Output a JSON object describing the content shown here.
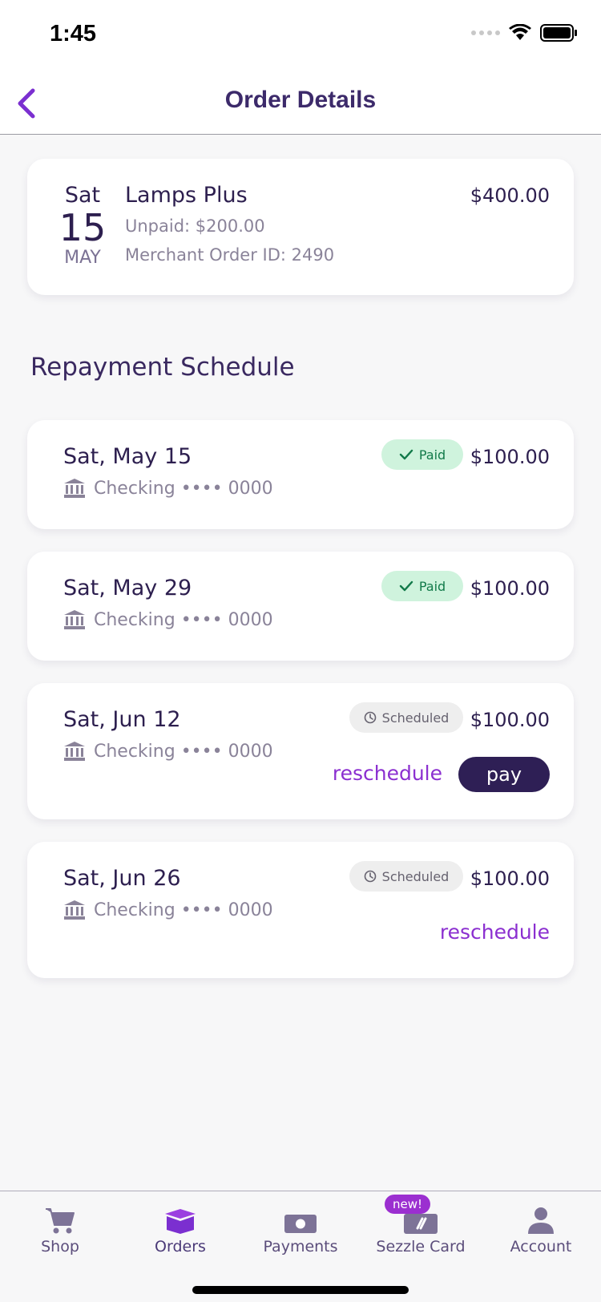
{
  "status_bar": {
    "time": "1:45"
  },
  "nav": {
    "title": "Order Details"
  },
  "order": {
    "day_of_week": "Sat",
    "day": "15",
    "month": "MAY",
    "merchant": "Lamps Plus",
    "unpaid": "Unpaid: $200.00",
    "merchant_order_id": "Merchant Order ID: 2490",
    "total": "$400.00"
  },
  "schedule": {
    "title": "Repayment Schedule",
    "payments": [
      {
        "date": "Sat, May 15",
        "account": "Checking •••• 0000",
        "status": "Paid",
        "amount": "$100.00"
      },
      {
        "date": "Sat, May 29",
        "account": "Checking •••• 0000",
        "status": "Paid",
        "amount": "$100.00"
      },
      {
        "date": "Sat, Jun 12",
        "account": "Checking •••• 0000",
        "status": "Scheduled",
        "amount": "$100.00",
        "reschedule_label": "reschedule",
        "pay_label": "pay"
      },
      {
        "date": "Sat, Jun 26",
        "account": "Checking •••• 0000",
        "status": "Scheduled",
        "amount": "$100.00",
        "reschedule_label": "reschedule"
      }
    ]
  },
  "tabs": [
    {
      "label": "Shop",
      "icon": "cart-icon",
      "active": false
    },
    {
      "label": "Orders",
      "icon": "box-icon",
      "active": true
    },
    {
      "label": "Payments",
      "icon": "cash-icon",
      "active": false
    },
    {
      "label": "Sezzle Card",
      "icon": "card-icon",
      "active": false,
      "badge": "new!"
    },
    {
      "label": "Account",
      "icon": "person-icon",
      "active": false
    }
  ],
  "colors": {
    "brand_purple": "#8b2fd0",
    "dark_purple": "#2e1f55",
    "paid_green_bg": "#cff3dd",
    "paid_green_text": "#127a4a"
  }
}
